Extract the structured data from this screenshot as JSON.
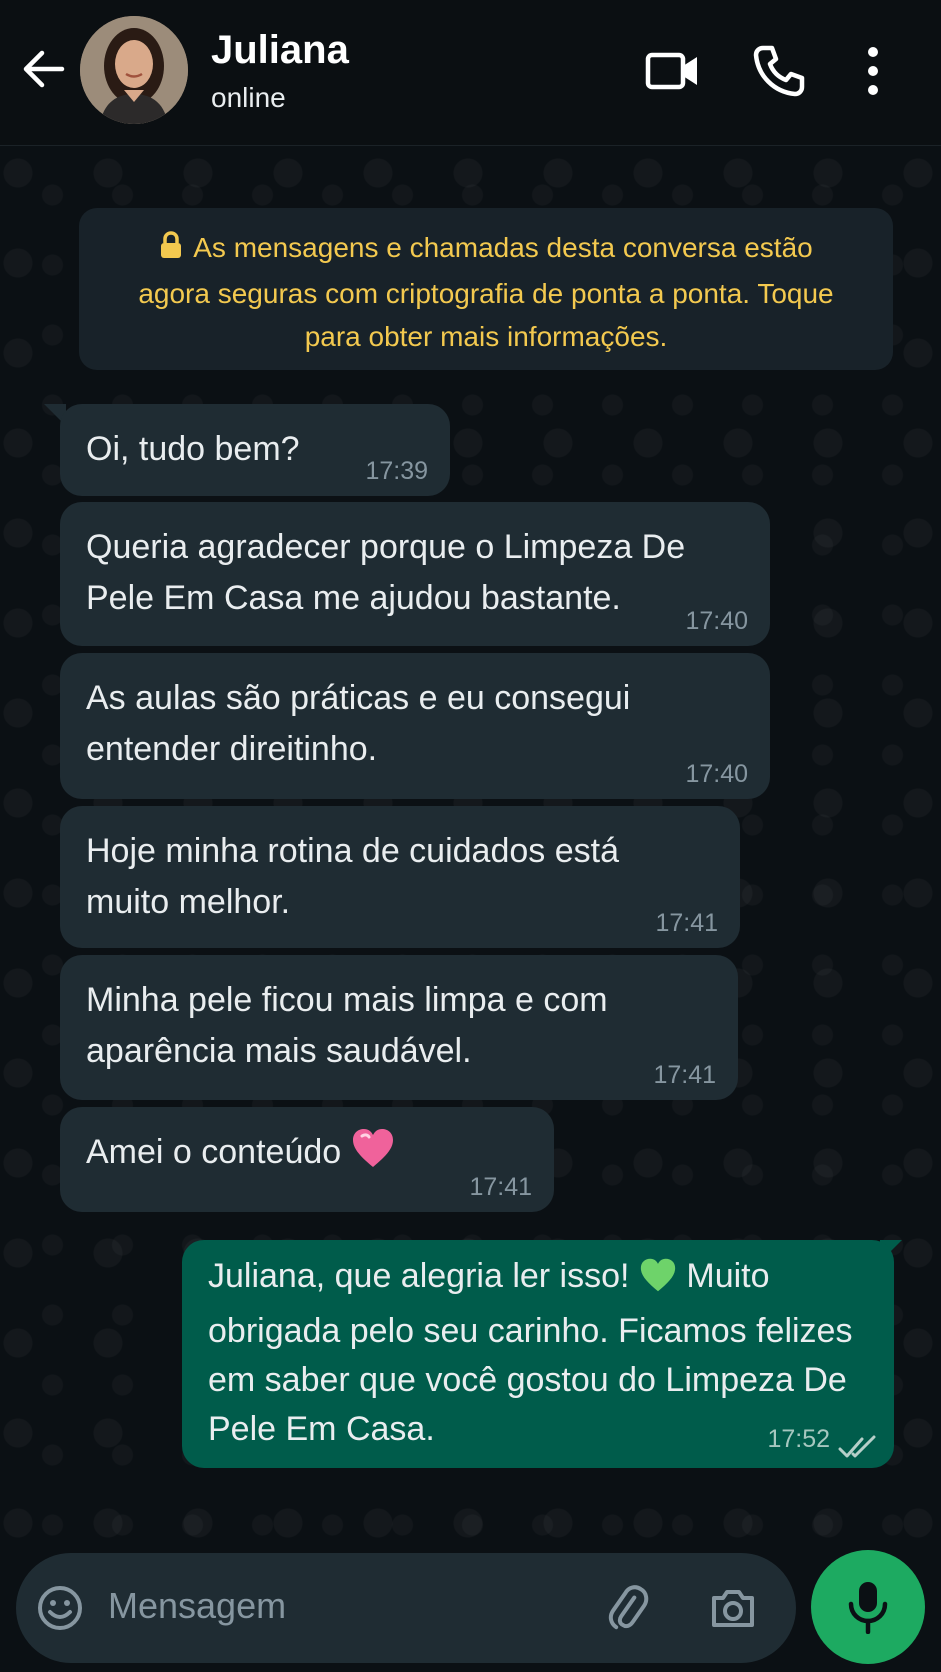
{
  "header": {
    "back_label": "back",
    "contact_name": "Juliana",
    "contact_status": "online"
  },
  "notice": {
    "line1": "As mensagens e chamadas desta conversa estão",
    "line2": "agora seguras com criptografia de ponta a ponta. Toque",
    "line3": "para obter mais informações."
  },
  "messages_in": [
    {
      "lines": [
        "Oi, tudo bem?"
      ],
      "time": "17:39"
    },
    {
      "lines": [
        "Queria agradecer porque o Limpeza De",
        "Pele Em Casa me ajudou bastante."
      ],
      "time": "17:40"
    },
    {
      "lines": [
        "As aulas são práticas e eu consegui",
        "entender direitinho."
      ],
      "time": "17:40"
    },
    {
      "lines": [
        "Hoje minha rotina de cuidados está",
        "muito melhor."
      ],
      "time": "17:41"
    },
    {
      "lines": [
        "Minha pele ficou mais limpa e com",
        "aparência mais saudável."
      ],
      "time": "17:41"
    },
    {
      "lines": [
        "Amei o conteúdo"
      ],
      "emoji": "pink-heart",
      "time": "17:41"
    }
  ],
  "message_out": {
    "line1_a": "Juliana, que alegria ler isso!",
    "line1_emoji": "green-heart",
    "line1_b": "Muito",
    "line2": "obrigada pelo seu carinho. Ficamos felizes",
    "line3": "em saber que você gostou do Limpeza De",
    "line4": "Pele Em Casa.",
    "time": "17:52",
    "status": "read"
  },
  "composer": {
    "placeholder": "Mensagem"
  },
  "colors": {
    "background": "#0b1014",
    "incoming_bubble": "#1f2c33",
    "outgoing_bubble": "#005c4b",
    "notice_text": "#f3c94f",
    "mic_button": "#1daa61"
  }
}
